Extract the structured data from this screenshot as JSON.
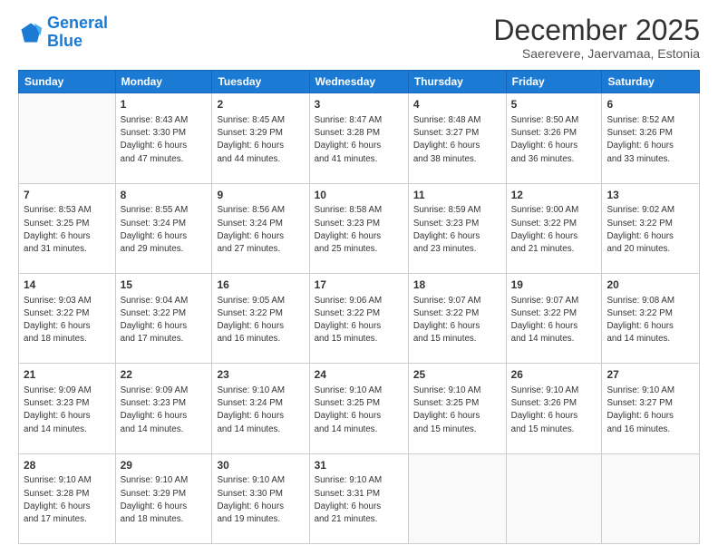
{
  "logo": {
    "line1": "General",
    "line2": "Blue"
  },
  "title": "December 2025",
  "subtitle": "Saerevere, Jaervamaa, Estonia",
  "header_days": [
    "Sunday",
    "Monday",
    "Tuesday",
    "Wednesday",
    "Thursday",
    "Friday",
    "Saturday"
  ],
  "weeks": [
    [
      {
        "day": "",
        "info": ""
      },
      {
        "day": "1",
        "info": "Sunrise: 8:43 AM\nSunset: 3:30 PM\nDaylight: 6 hours\nand 47 minutes."
      },
      {
        "day": "2",
        "info": "Sunrise: 8:45 AM\nSunset: 3:29 PM\nDaylight: 6 hours\nand 44 minutes."
      },
      {
        "day": "3",
        "info": "Sunrise: 8:47 AM\nSunset: 3:28 PM\nDaylight: 6 hours\nand 41 minutes."
      },
      {
        "day": "4",
        "info": "Sunrise: 8:48 AM\nSunset: 3:27 PM\nDaylight: 6 hours\nand 38 minutes."
      },
      {
        "day": "5",
        "info": "Sunrise: 8:50 AM\nSunset: 3:26 PM\nDaylight: 6 hours\nand 36 minutes."
      },
      {
        "day": "6",
        "info": "Sunrise: 8:52 AM\nSunset: 3:26 PM\nDaylight: 6 hours\nand 33 minutes."
      }
    ],
    [
      {
        "day": "7",
        "info": "Sunrise: 8:53 AM\nSunset: 3:25 PM\nDaylight: 6 hours\nand 31 minutes."
      },
      {
        "day": "8",
        "info": "Sunrise: 8:55 AM\nSunset: 3:24 PM\nDaylight: 6 hours\nand 29 minutes."
      },
      {
        "day": "9",
        "info": "Sunrise: 8:56 AM\nSunset: 3:24 PM\nDaylight: 6 hours\nand 27 minutes."
      },
      {
        "day": "10",
        "info": "Sunrise: 8:58 AM\nSunset: 3:23 PM\nDaylight: 6 hours\nand 25 minutes."
      },
      {
        "day": "11",
        "info": "Sunrise: 8:59 AM\nSunset: 3:23 PM\nDaylight: 6 hours\nand 23 minutes."
      },
      {
        "day": "12",
        "info": "Sunrise: 9:00 AM\nSunset: 3:22 PM\nDaylight: 6 hours\nand 21 minutes."
      },
      {
        "day": "13",
        "info": "Sunrise: 9:02 AM\nSunset: 3:22 PM\nDaylight: 6 hours\nand 20 minutes."
      }
    ],
    [
      {
        "day": "14",
        "info": "Sunrise: 9:03 AM\nSunset: 3:22 PM\nDaylight: 6 hours\nand 18 minutes."
      },
      {
        "day": "15",
        "info": "Sunrise: 9:04 AM\nSunset: 3:22 PM\nDaylight: 6 hours\nand 17 minutes."
      },
      {
        "day": "16",
        "info": "Sunrise: 9:05 AM\nSunset: 3:22 PM\nDaylight: 6 hours\nand 16 minutes."
      },
      {
        "day": "17",
        "info": "Sunrise: 9:06 AM\nSunset: 3:22 PM\nDaylight: 6 hours\nand 15 minutes."
      },
      {
        "day": "18",
        "info": "Sunrise: 9:07 AM\nSunset: 3:22 PM\nDaylight: 6 hours\nand 15 minutes."
      },
      {
        "day": "19",
        "info": "Sunrise: 9:07 AM\nSunset: 3:22 PM\nDaylight: 6 hours\nand 14 minutes."
      },
      {
        "day": "20",
        "info": "Sunrise: 9:08 AM\nSunset: 3:22 PM\nDaylight: 6 hours\nand 14 minutes."
      }
    ],
    [
      {
        "day": "21",
        "info": "Sunrise: 9:09 AM\nSunset: 3:23 PM\nDaylight: 6 hours\nand 14 minutes."
      },
      {
        "day": "22",
        "info": "Sunrise: 9:09 AM\nSunset: 3:23 PM\nDaylight: 6 hours\nand 14 minutes."
      },
      {
        "day": "23",
        "info": "Sunrise: 9:10 AM\nSunset: 3:24 PM\nDaylight: 6 hours\nand 14 minutes."
      },
      {
        "day": "24",
        "info": "Sunrise: 9:10 AM\nSunset: 3:25 PM\nDaylight: 6 hours\nand 14 minutes."
      },
      {
        "day": "25",
        "info": "Sunrise: 9:10 AM\nSunset: 3:25 PM\nDaylight: 6 hours\nand 15 minutes."
      },
      {
        "day": "26",
        "info": "Sunrise: 9:10 AM\nSunset: 3:26 PM\nDaylight: 6 hours\nand 15 minutes."
      },
      {
        "day": "27",
        "info": "Sunrise: 9:10 AM\nSunset: 3:27 PM\nDaylight: 6 hours\nand 16 minutes."
      }
    ],
    [
      {
        "day": "28",
        "info": "Sunrise: 9:10 AM\nSunset: 3:28 PM\nDaylight: 6 hours\nand 17 minutes."
      },
      {
        "day": "29",
        "info": "Sunrise: 9:10 AM\nSunset: 3:29 PM\nDaylight: 6 hours\nand 18 minutes."
      },
      {
        "day": "30",
        "info": "Sunrise: 9:10 AM\nSunset: 3:30 PM\nDaylight: 6 hours\nand 19 minutes."
      },
      {
        "day": "31",
        "info": "Sunrise: 9:10 AM\nSunset: 3:31 PM\nDaylight: 6 hours\nand 21 minutes."
      },
      {
        "day": "",
        "info": ""
      },
      {
        "day": "",
        "info": ""
      },
      {
        "day": "",
        "info": ""
      }
    ]
  ]
}
